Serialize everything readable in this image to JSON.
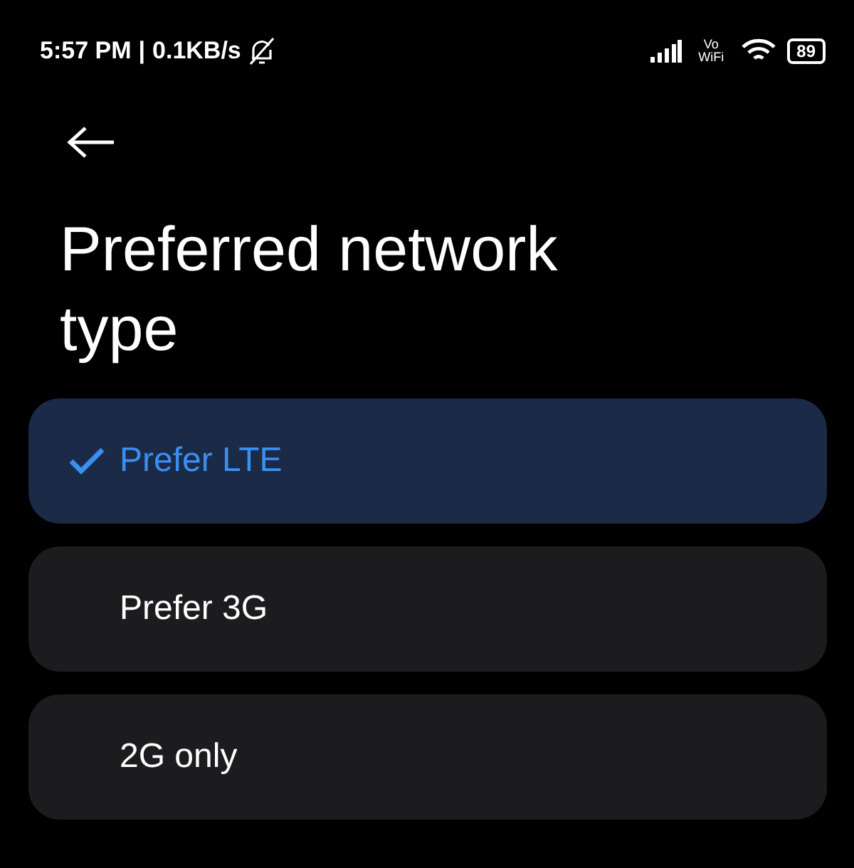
{
  "status_bar": {
    "time": "5:57 PM",
    "separator": "|",
    "speed": "0.1KB/s",
    "vowifi": "Vo WiFi",
    "battery": "89"
  },
  "title": "Preferred network type",
  "options": [
    {
      "label": "Prefer LTE",
      "selected": true
    },
    {
      "label": "Prefer 3G",
      "selected": false
    },
    {
      "label": "2G only",
      "selected": false
    }
  ]
}
